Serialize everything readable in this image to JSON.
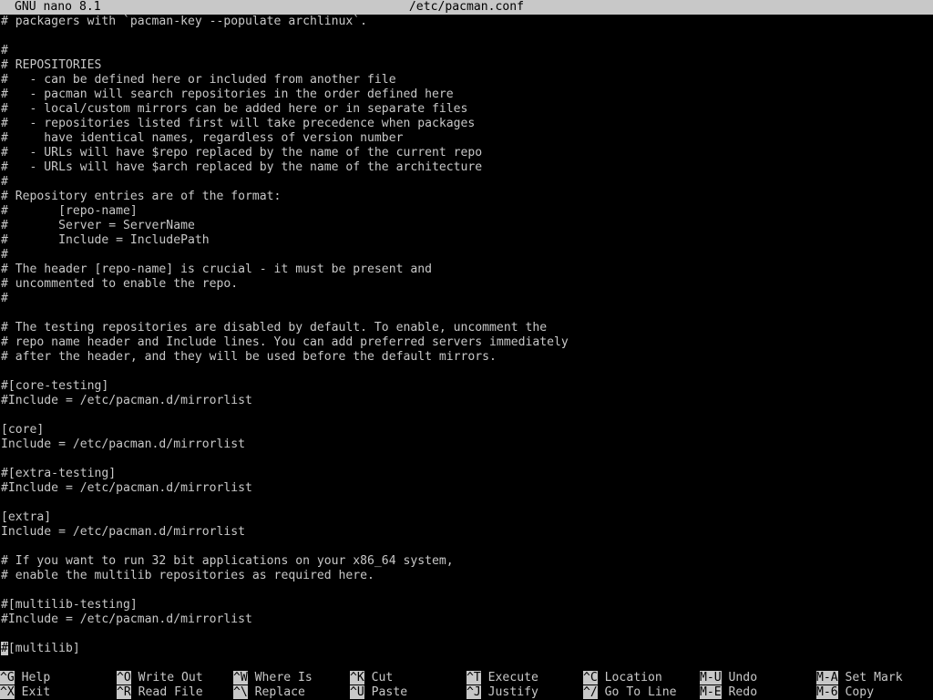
{
  "titlebar": {
    "app": "GNU nano 8.1",
    "filename": "/etc/pacman.conf"
  },
  "editor": {
    "lines": [
      "# packagers with `pacman-key --populate archlinux`.",
      "",
      "#",
      "# REPOSITORIES",
      "#   - can be defined here or included from another file",
      "#   - pacman will search repositories in the order defined here",
      "#   - local/custom mirrors can be added here or in separate files",
      "#   - repositories listed first will take precedence when packages",
      "#     have identical names, regardless of version number",
      "#   - URLs will have $repo replaced by the name of the current repo",
      "#   - URLs will have $arch replaced by the name of the architecture",
      "#",
      "# Repository entries are of the format:",
      "#       [repo-name]",
      "#       Server = ServerName",
      "#       Include = IncludePath",
      "#",
      "# The header [repo-name] is crucial - it must be present and",
      "# uncommented to enable the repo.",
      "#",
      "",
      "# The testing repositories are disabled by default. To enable, uncomment the",
      "# repo name header and Include lines. You can add preferred servers immediately",
      "# after the header, and they will be used before the default mirrors.",
      "",
      "#[core-testing]",
      "#Include = /etc/pacman.d/mirrorlist",
      "",
      "[core]",
      "Include = /etc/pacman.d/mirrorlist",
      "",
      "#[extra-testing]",
      "#Include = /etc/pacman.d/mirrorlist",
      "",
      "[extra]",
      "Include = /etc/pacman.d/mirrorlist",
      "",
      "# If you want to run 32 bit applications on your x86_64 system,",
      "# enable the multilib repositories as required here.",
      "",
      "#[multilib-testing]",
      "#Include = /etc/pacman.d/mirrorlist",
      "",
      "#[multilib]"
    ],
    "cursor_line_index": 43,
    "cursor_char": "#",
    "cursor_rest": "[multilib]"
  },
  "shortcuts": [
    {
      "key": "^G",
      "label": "Help"
    },
    {
      "key": "^O",
      "label": "Write Out"
    },
    {
      "key": "^W",
      "label": "Where Is"
    },
    {
      "key": "^K",
      "label": "Cut"
    },
    {
      "key": "^T",
      "label": "Execute"
    },
    {
      "key": "^C",
      "label": "Location"
    },
    {
      "key": "M-U",
      "label": "Undo"
    },
    {
      "key": "M-A",
      "label": "Set Mark"
    },
    {
      "key": "^X",
      "label": "Exit"
    },
    {
      "key": "^R",
      "label": "Read File"
    },
    {
      "key": "^\\",
      "label": "Replace"
    },
    {
      "key": "^U",
      "label": "Paste"
    },
    {
      "key": "^J",
      "label": "Justify"
    },
    {
      "key": "^/",
      "label": "Go To Line"
    },
    {
      "key": "M-E",
      "label": "Redo"
    },
    {
      "key": "M-6",
      "label": "Copy"
    }
  ],
  "colors": {
    "background": "#000000",
    "text": "#c8c8c8",
    "inverse_bg": "#c8c8c8",
    "inverse_text": "#000000"
  }
}
